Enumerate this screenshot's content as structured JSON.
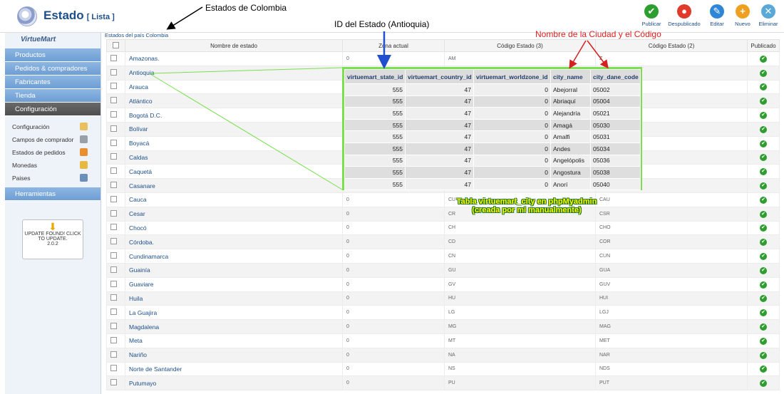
{
  "header": {
    "title": "Estado",
    "subtitle": "[ Lista ]",
    "toolbar": [
      {
        "label": "Publicar",
        "color": "#2e9e2e",
        "glyph": "✔",
        "icon": "check-icon"
      },
      {
        "label": "Despublicado",
        "color": "#e03a2a",
        "glyph": "●",
        "icon": "unpublish-icon"
      },
      {
        "label": "Editar",
        "color": "#2f86d6",
        "glyph": "✎",
        "icon": "edit-icon"
      },
      {
        "label": "Nuevo",
        "color": "#f0a020",
        "glyph": "+",
        "icon": "plus-icon"
      },
      {
        "label": "Eliminar",
        "color": "#58a8d8",
        "glyph": "✕",
        "icon": "trash-icon"
      }
    ]
  },
  "annotations": {
    "estados": "Estados de Colombia",
    "id_estado": "ID del Estado (Antioquia)",
    "ciudad": "Nombre de la Ciudad y el Código",
    "tabla_line1": "Tabla virtuemart_city en phpMyadmin",
    "tabla_line2": "(creada por mi manualmente)"
  },
  "sidebar": {
    "logo": "VirtueMart",
    "nav": [
      "Productos",
      "Pedidos & compradores",
      "Fabricantes",
      "Tienda",
      "Configuración"
    ],
    "active": "Configuración",
    "sub_items": [
      {
        "label": "Configuración",
        "color": "#e8c060"
      },
      {
        "label": "Campos de comprador",
        "color": "#9aa0a8"
      },
      {
        "label": "Estados de pedidos",
        "color": "#e89030"
      },
      {
        "label": "Monedas",
        "color": "#e8b840"
      },
      {
        "label": "Paises",
        "color": "#6a90b8"
      }
    ],
    "herramientas": "Herramientas",
    "update": {
      "line1": "UPDATE FOUND! CLICK",
      "line2": "TO UPDATE.",
      "version": "2.0.2"
    }
  },
  "main": {
    "caption": "Estados del país Colombia",
    "columns": [
      "Nombre de estado",
      "Zona actual",
      "Código Estado (3)",
      "Código Estado (2)",
      "Publicado"
    ],
    "rows": [
      {
        "name": "Amazonas.",
        "zone": "0",
        "c2": "AM",
        "c3": "Z"
      },
      {
        "name": "Antioquia",
        "zone": "",
        "c2": "",
        "c3": ""
      },
      {
        "name": "Arauca",
        "zone": "",
        "c2": "",
        "c3": ""
      },
      {
        "name": "Atlántico",
        "zone": "",
        "c2": "",
        "c3": ""
      },
      {
        "name": "Bogotá D.C.",
        "zone": "",
        "c2": "",
        "c3": ""
      },
      {
        "name": "Bolívar",
        "zone": "",
        "c2": "",
        "c3": ""
      },
      {
        "name": "Boyacá",
        "zone": "",
        "c2": "",
        "c3": ""
      },
      {
        "name": "Caldas",
        "zone": "",
        "c2": "",
        "c3": ""
      },
      {
        "name": "Caquetá",
        "zone": "",
        "c2": "",
        "c3": ""
      },
      {
        "name": "Casanare",
        "zone": "",
        "c2": "",
        "c3": ""
      },
      {
        "name": "Cauca",
        "zone": "0",
        "c2": "CU",
        "c3": "CAU"
      },
      {
        "name": "Cesar",
        "zone": "0",
        "c2": "CR",
        "c3": "CSR"
      },
      {
        "name": "Chocó",
        "zone": "0",
        "c2": "CH",
        "c3": "CHO"
      },
      {
        "name": "Córdoba.",
        "zone": "0",
        "c2": "CD",
        "c3": "COR"
      },
      {
        "name": "Cundinamarca",
        "zone": "0",
        "c2": "CN",
        "c3": "CUN"
      },
      {
        "name": "Guainía",
        "zone": "0",
        "c2": "GU",
        "c3": "GUA"
      },
      {
        "name": "Guaviare",
        "zone": "0",
        "c2": "GV",
        "c3": "GUV"
      },
      {
        "name": "Huila",
        "zone": "0",
        "c2": "HU",
        "c3": "HUI"
      },
      {
        "name": "La Guajira",
        "zone": "0",
        "c2": "LG",
        "c3": "LGJ"
      },
      {
        "name": "Magdalena",
        "zone": "0",
        "c2": "MG",
        "c3": "MAG"
      },
      {
        "name": "Meta",
        "zone": "0",
        "c2": "MT",
        "c3": "MET"
      },
      {
        "name": "Nariño",
        "zone": "0",
        "c2": "NA",
        "c3": "NAR"
      },
      {
        "name": "Norte de Santander",
        "zone": "0",
        "c2": "NS",
        "c3": "NDS"
      },
      {
        "name": "Putumayo",
        "zone": "0",
        "c2": "PU",
        "c3": "PUT"
      }
    ]
  },
  "city_table": {
    "columns": [
      "virtuemart_state_id",
      "virtuemart_country_id",
      "virtuemart_worldzone_id",
      "city_name",
      "city_dane_code"
    ],
    "rows": [
      [
        "555",
        "47",
        "0",
        "Abejorral",
        "05002"
      ],
      [
        "555",
        "47",
        "0",
        "Abriaquí",
        "05004"
      ],
      [
        "555",
        "47",
        "0",
        "Alejandría",
        "05021"
      ],
      [
        "555",
        "47",
        "0",
        "Amagá",
        "05030"
      ],
      [
        "555",
        "47",
        "0",
        "Amalfi",
        "05031"
      ],
      [
        "555",
        "47",
        "0",
        "Andes",
        "05034"
      ],
      [
        "555",
        "47",
        "0",
        "Angelópolis",
        "05036"
      ],
      [
        "555",
        "47",
        "0",
        "Angostura",
        "05038"
      ],
      [
        "555",
        "47",
        "0",
        "Anorí",
        "05040"
      ]
    ]
  }
}
